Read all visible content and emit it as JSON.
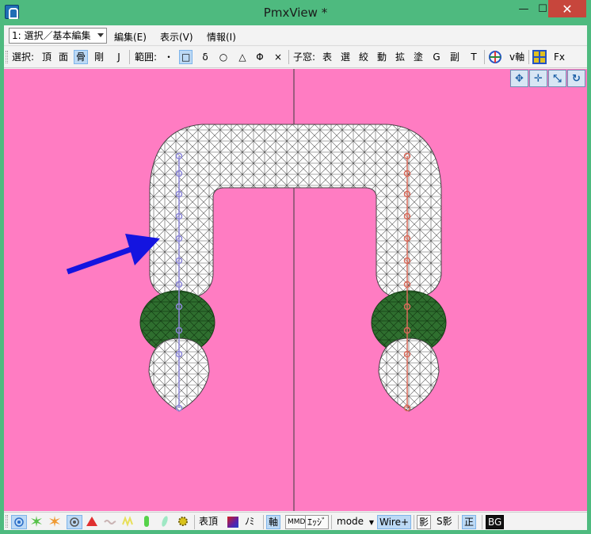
{
  "window": {
    "title": "PmxView *",
    "min_glyph": "—",
    "max_glyph": "☐",
    "close_glyph": "✕"
  },
  "menubar": {
    "mode_select_value": "1: 選択／基本編集",
    "items": [
      "編集(E)",
      "表示(V)",
      "情報(I)"
    ]
  },
  "toolbar": {
    "select_label": "選択:",
    "select_items": [
      "頂",
      "面",
      "骨",
      "剛",
      "J"
    ],
    "select_active": "骨",
    "range_label": "範囲:",
    "range_items": [
      "・",
      "□",
      "δ",
      "○",
      "△",
      "Φ",
      "×"
    ],
    "range_active": "□",
    "child_label": "子窓:",
    "child_items": [
      "表",
      "選",
      "絞",
      "動",
      "拡",
      "塗",
      "G",
      "副",
      "T"
    ],
    "axis_label": "v軸",
    "fx_label": "Fx",
    "axis_icon_colors": [
      "#e23b3b",
      "#2a8a3a",
      "#2453c4",
      "#e0c020"
    ]
  },
  "viewport": {
    "background": "#ff7cc2",
    "icons": [
      "move-xy-icon",
      "move-all-icon",
      "zoom-icon",
      "rotate-icon"
    ],
    "icon_glyphs": [
      "✥",
      "✛",
      "⤡",
      "↻"
    ],
    "arrow_color": "#1414e0",
    "mesh_color": "#ffffff",
    "ring_color": "#2e6b2e",
    "left_bone_color": "#8b86d8",
    "right_bone_color": "#d86a5a"
  },
  "bottombar": {
    "icons": [
      "vertex-select-icon",
      "green-burst-icon",
      "orange-burst-icon",
      "bone-point-icon",
      "red-triangle-icon",
      "wave-icon",
      "yellow-zigzag-icon",
      "green-capsule-icon",
      "teal-leaf-icon",
      "yellow-gear-icon"
    ],
    "vertex_label": "表頂",
    "material_swatch": "#5a1fa8",
    "slash_label": "ﾉﾐ",
    "axis_label": "軸",
    "mmd_label": "MMD",
    "edge_label": "ｴｯｼﾞ",
    "mode_label": "mode",
    "wire_label": "Wire+",
    "shadow_label": "影",
    "sshadow_label": "S影",
    "front_label": "正",
    "bg_label": "BG"
  }
}
